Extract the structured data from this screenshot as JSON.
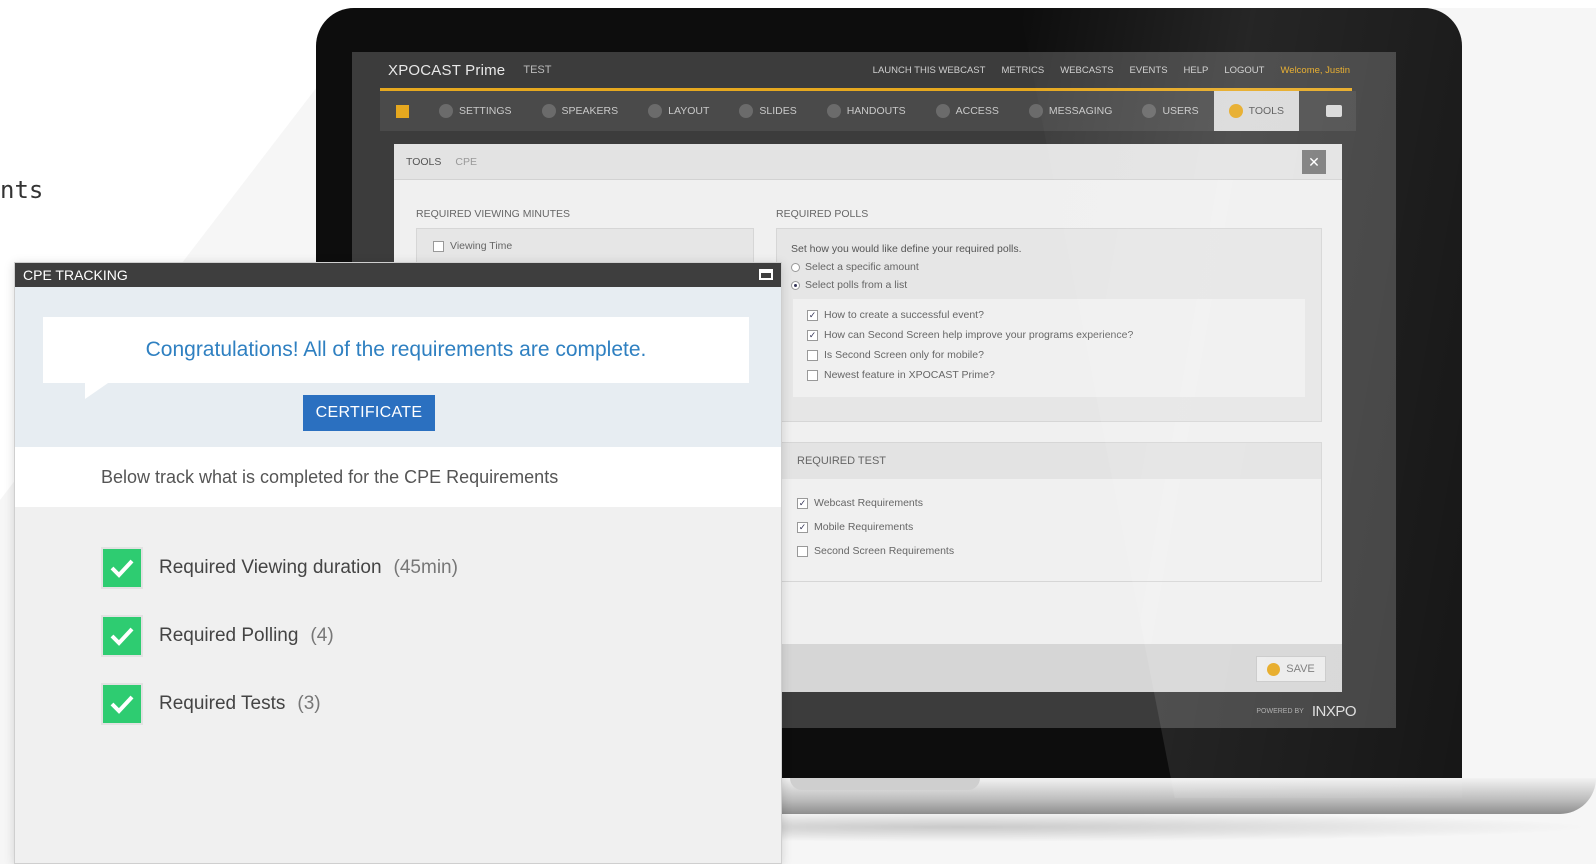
{
  "page": {
    "cut_text": "nts"
  },
  "app": {
    "brand": "XPOCAST Prime",
    "test_label": "TEST",
    "top_links": [
      "LAUNCH THIS WEBCAST",
      "METRICS",
      "WEBCASTS",
      "EVENTS",
      "HELP",
      "LOGOUT"
    ],
    "welcome": "Welcome, Justin",
    "nav": [
      {
        "label": "SETTINGS",
        "icon": "settings-icon",
        "active": false
      },
      {
        "label": "SPEAKERS",
        "icon": "speakers-icon",
        "active": false
      },
      {
        "label": "LAYOUT",
        "icon": "layout-icon",
        "active": false
      },
      {
        "label": "SLIDES",
        "icon": "slides-icon",
        "active": false
      },
      {
        "label": "HANDOUTS",
        "icon": "handouts-icon",
        "active": false
      },
      {
        "label": "ACCESS",
        "icon": "access-icon",
        "active": false
      },
      {
        "label": "MESSAGING",
        "icon": "messaging-icon",
        "active": false
      },
      {
        "label": "USERS",
        "icon": "users-icon",
        "active": false
      },
      {
        "label": "TOOLS",
        "icon": "tools-icon",
        "active": true
      }
    ],
    "panel": {
      "crumb1": "TOOLS",
      "crumb2": "CPE",
      "close": "✕",
      "viewing": {
        "label": "REQUIRED VIEWING MINUTES",
        "checkbox": "Viewing Time",
        "checked": false
      },
      "polls": {
        "label": "REQUIRED POLLS",
        "intro": "Set how you would like define your required polls.",
        "options": [
          {
            "label": "Select a specific amount",
            "selected": false
          },
          {
            "label": "Select polls from a list",
            "selected": true
          }
        ],
        "items": [
          {
            "label": "How to create a successful event?",
            "checked": true
          },
          {
            "label": "How can Second Screen help improve your programs experience?",
            "checked": true
          },
          {
            "label": "Is Second Screen only for mobile?",
            "checked": false
          },
          {
            "label": "Newest feature in XPOCAST Prime?",
            "checked": false
          }
        ]
      },
      "test": {
        "label": "REQUIRED TEST",
        "items": [
          {
            "label": "Webcast Requirements",
            "checked": true
          },
          {
            "label": "Mobile Requirements",
            "checked": true
          },
          {
            "label": "Second Screen Requirements",
            "checked": false
          }
        ]
      },
      "save": "SAVE",
      "powered_by": "POWERED BY",
      "powered_logo": "INXPO"
    }
  },
  "cpe": {
    "title": "CPE TRACKING",
    "message": "Congratulations! All of the requirements are complete.",
    "certificate": "CERTIFICATE",
    "subtitle": "Below track what is completed for the CPE Requirements",
    "requirements": [
      {
        "label": "Required Viewing duration",
        "count": "(45min)"
      },
      {
        "label": "Required Polling",
        "count": "(4)"
      },
      {
        "label": "Required Tests",
        "count": "(3)"
      }
    ]
  },
  "colors": {
    "accent": "#e6a81f",
    "primary": "#2b70c0",
    "success": "#2ecc71",
    "message": "#2f80c1"
  }
}
